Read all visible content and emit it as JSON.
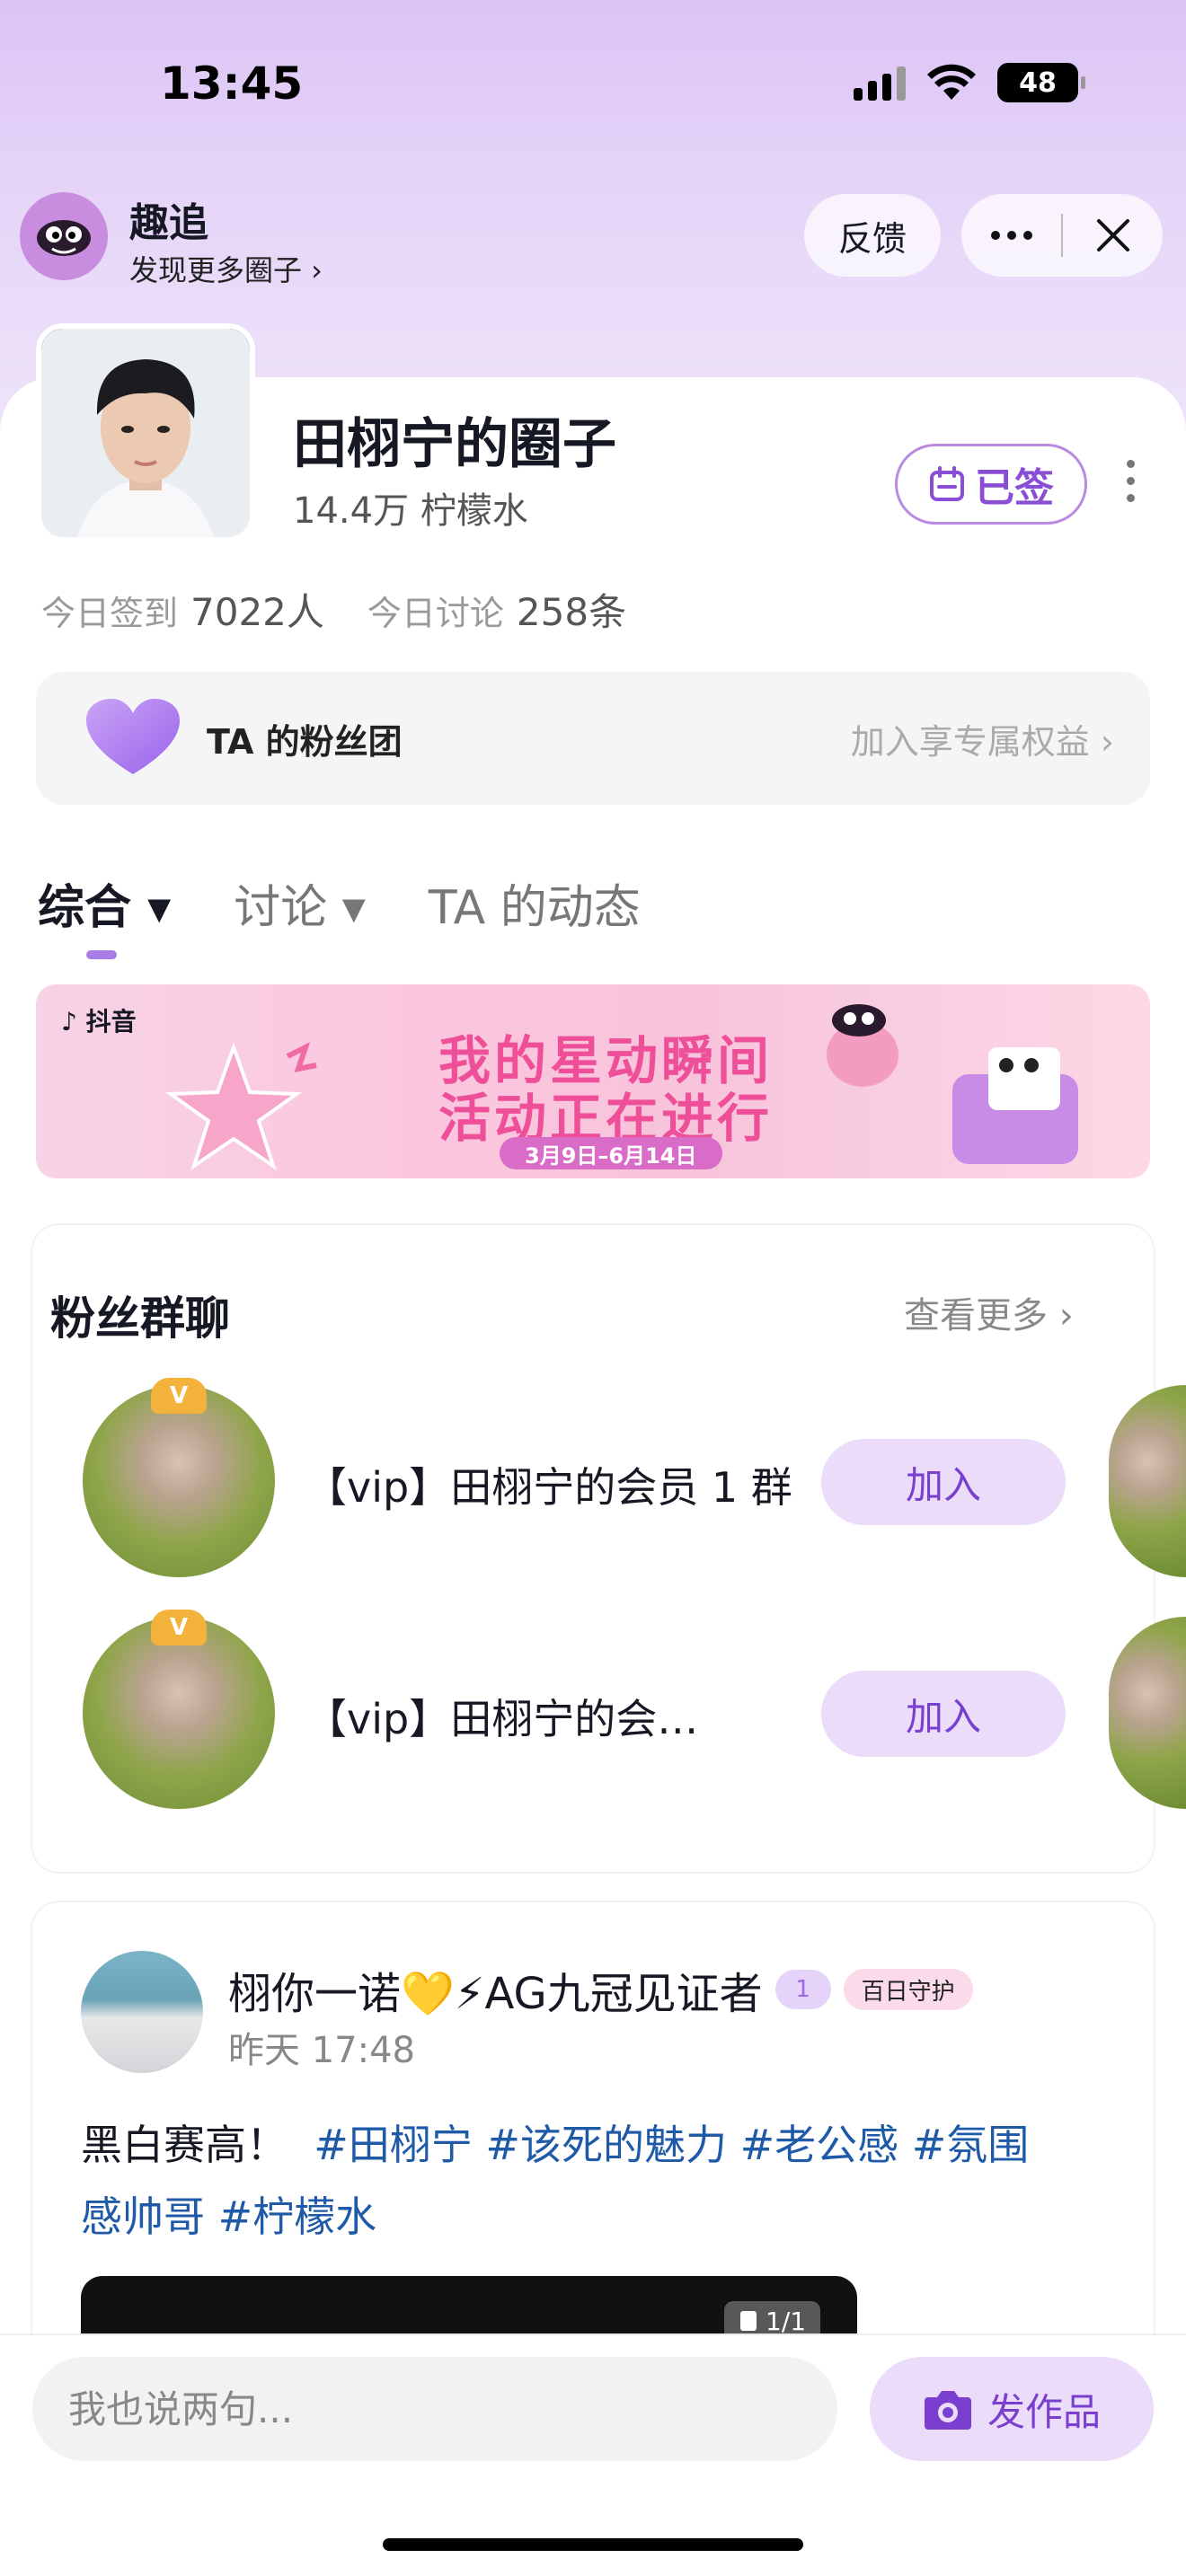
{
  "status_bar": {
    "time": "13:45",
    "battery": "48"
  },
  "app_header": {
    "app_name": "趣追",
    "subtitle": "发现更多圈子 ›",
    "feedback_label": "反馈"
  },
  "circle": {
    "title": "田栩宁的圈子",
    "fan_count": "14.4万 柠檬水",
    "signed_label": "已签",
    "checkin_label": "今日签到",
    "checkin_value": "7022人",
    "discuss_label": "今日讨论",
    "discuss_value": "258条"
  },
  "fan_club": {
    "title": "TA 的粉丝团",
    "link": "加入享专属权益 ›"
  },
  "tabs": [
    {
      "label": "综合 ▾"
    },
    {
      "label": "讨论 ▾"
    },
    {
      "label": "TA 的动态"
    }
  ],
  "banner": {
    "logo": "♪ 抖音",
    "line1": "我的星动瞬间",
    "line2": "活动正在进行",
    "date": "3月9日–6月14日"
  },
  "group_chat": {
    "title": "粉丝群聊",
    "more": "查看更多 ›",
    "groups": [
      {
        "name": "【vip】田栩宁的会员 1 群",
        "badge": "V",
        "join_label": "加入"
      },
      {
        "name": "【vip】田栩宁的会…",
        "badge": "V",
        "join_label": "加入"
      }
    ]
  },
  "post": {
    "author": "栩你一诺💛⚡AG九冠见证者",
    "level": "1",
    "guard_badge": "百日守护",
    "time": "昨天 17:48",
    "text": "黑白赛高！",
    "tags_line1": "#田栩宁 #该死的魅力 #老公感 #氛围",
    "tags_line2": "感帅哥 #柠檬水",
    "media_count": "1/1"
  },
  "bottom_bar": {
    "input_placeholder": "我也说两句...",
    "publish_label": "发作品"
  },
  "colors": {
    "accent_purple": "#7b3fd0",
    "tag_blue": "#1e5aa8",
    "banner_pink": "#ee4f98"
  }
}
